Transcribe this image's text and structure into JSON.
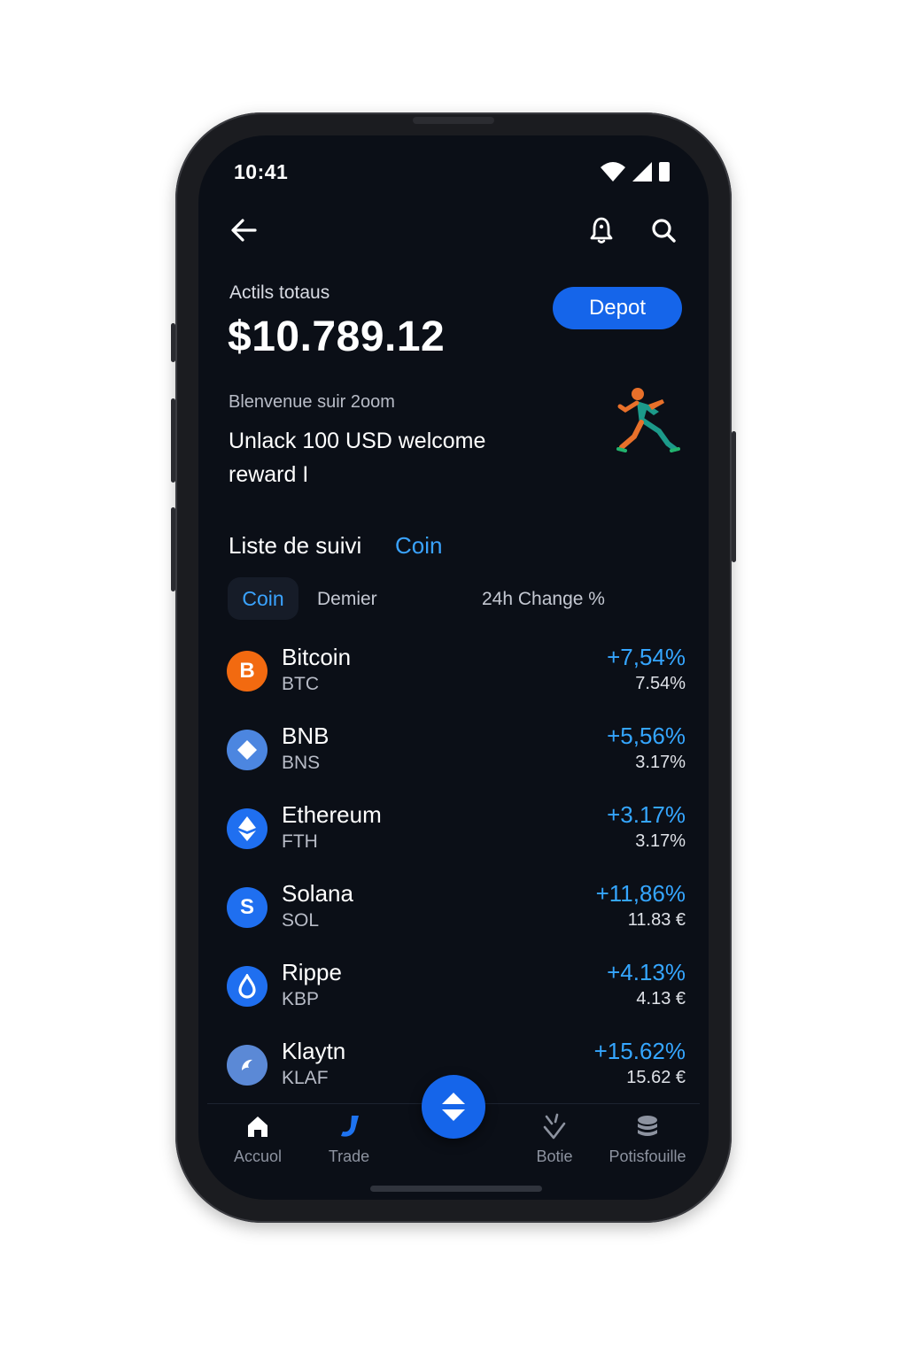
{
  "status": {
    "time": "10:41"
  },
  "header": {
    "back_icon": "arrow-left-icon",
    "notification_icon": "bell-icon",
    "search_icon": "search-icon"
  },
  "balance": {
    "label": "Actils totaus",
    "value": "$10.789.12",
    "deposit_label": "Depot"
  },
  "promo": {
    "subtitle": "Blenvenue suir 2oom",
    "title": "Unlack 100 USD welcome reward I",
    "illustration": "runner-illustration"
  },
  "watchlist": {
    "title": "Liste de suivi",
    "link": "Coin",
    "columns": {
      "coin": "Coin",
      "last": "Demier",
      "change": "24h Change %"
    },
    "coins": [
      {
        "name": "Bitcoin",
        "symbol": "BTC",
        "change": "+7,54%",
        "sub": "7.54%",
        "icon": "B",
        "color": "#f26a10"
      },
      {
        "name": "BNB",
        "symbol": "BNS",
        "change": "+5,56%",
        "sub": "3.17%",
        "icon": "diamond",
        "color": "#4c86e0"
      },
      {
        "name": "Ethereum",
        "symbol": "FTH",
        "change": "+3.17%",
        "sub": "3.17%",
        "icon": "eth",
        "color": "#1f6ff0"
      },
      {
        "name": "Solana",
        "symbol": "SOL",
        "change": "+11,86%",
        "sub": "11.83 €",
        "icon": "S",
        "color": "#1f6ff0"
      },
      {
        "name": "Rippe",
        "symbol": "KBP",
        "change": "+4.13%",
        "sub": "4.13 €",
        "icon": "drop",
        "color": "#1f6ff0"
      },
      {
        "name": "Klaytn",
        "symbol": "KLAF",
        "change": "+15.62%",
        "sub": "15.62 €",
        "icon": "klay",
        "color": "#5b89d6"
      }
    ]
  },
  "nav": {
    "items": [
      {
        "label": "Accuol",
        "icon": "home-icon"
      },
      {
        "label": "Trade",
        "icon": "trade-icon"
      },
      {
        "label": "Botie",
        "icon": "bot-icon"
      },
      {
        "label": "Potisfouille",
        "icon": "wallet-icon"
      }
    ],
    "fab_icon": "swap-icon"
  }
}
